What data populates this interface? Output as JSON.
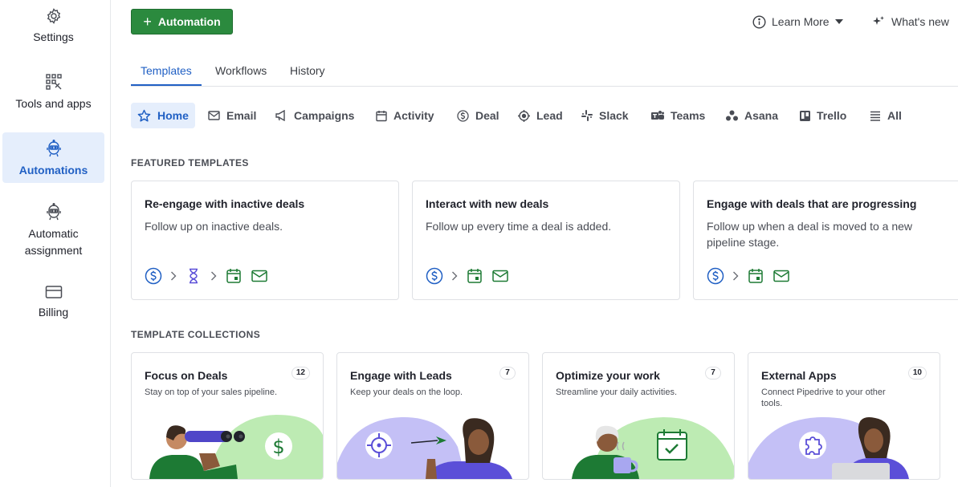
{
  "sidebar": {
    "items": [
      {
        "label": "Settings",
        "icon": "gear-icon"
      },
      {
        "label": "Tools and apps",
        "icon": "apps-icon"
      },
      {
        "label": "Automations",
        "icon": "robot-icon",
        "active": true
      },
      {
        "label": "Automatic assignment",
        "icon": "robot-icon"
      },
      {
        "label": "Billing",
        "icon": "credit-card-icon"
      }
    ]
  },
  "header": {
    "add_button_label": "Automation",
    "learn_more_label": "Learn More",
    "whats_new_label": "What's new"
  },
  "tabs": [
    {
      "label": "Templates",
      "active": true
    },
    {
      "label": "Workflows"
    },
    {
      "label": "History"
    }
  ],
  "filters": [
    {
      "label": "Home",
      "icon": "star-icon",
      "active": true
    },
    {
      "label": "Email",
      "icon": "mail-icon"
    },
    {
      "label": "Campaigns",
      "icon": "megaphone-icon"
    },
    {
      "label": "Activity",
      "icon": "calendar-icon"
    },
    {
      "label": "Deal",
      "icon": "dollar-icon"
    },
    {
      "label": "Lead",
      "icon": "target-icon"
    },
    {
      "label": "Slack",
      "icon": "slack-icon"
    },
    {
      "label": "Teams",
      "icon": "teams-icon"
    },
    {
      "label": "Asana",
      "icon": "asana-icon"
    },
    {
      "label": "Trello",
      "icon": "trello-icon"
    },
    {
      "label": "All",
      "icon": "list-icon"
    }
  ],
  "featured": {
    "title": "FEATURED TEMPLATES",
    "cards": [
      {
        "title": "Re-engage with inactive deals",
        "desc": "Follow up on inactive deals."
      },
      {
        "title": "Interact with new deals",
        "desc": "Follow up every time a deal is added."
      },
      {
        "title": "Engage with deals that are progressing",
        "desc": "Follow up when a deal is moved to a new pipeline stage."
      }
    ]
  },
  "collections": {
    "title": "TEMPLATE COLLECTIONS",
    "cards": [
      {
        "title": "Focus on Deals",
        "desc": "Stay on top of your sales pipeline.",
        "count": "12"
      },
      {
        "title": "Engage with Leads",
        "desc": "Keep your deals on the loop.",
        "count": "7"
      },
      {
        "title": "Optimize your work",
        "desc": "Streamline your daily activities.",
        "count": "7"
      },
      {
        "title": "External Apps",
        "desc": "Connect Pipedrive to your other tools.",
        "count": "10"
      }
    ]
  },
  "colors": {
    "accent_blue": "#2160c4",
    "primary_green": "#2b8a3e",
    "active_bg": "#e5eefc",
    "illus_green": "#bdebb3",
    "illus_purple": "#c4c0f6"
  }
}
